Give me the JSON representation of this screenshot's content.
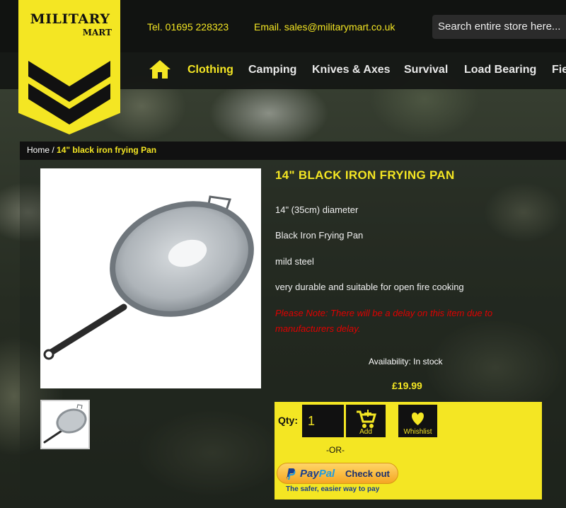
{
  "header": {
    "brand_line1": "MILITARY",
    "brand_line2": "MART",
    "phone": "Tel. 01695 228323",
    "email": "Email. sales@militarymart.co.uk",
    "search_placeholder": "Search entire store here..."
  },
  "nav": {
    "home_icon": "home-icon",
    "items": [
      "Clothing",
      "Camping",
      "Knives & Axes",
      "Survival",
      "Load Bearing",
      "Fie"
    ],
    "active": "Clothing"
  },
  "breadcrumb": {
    "home": "Home",
    "separator": " / ",
    "current": "14\" black iron frying Pan"
  },
  "product": {
    "title": "14\" BLACK IRON FRYING PAN",
    "features": [
      "14\" (35cm) diameter",
      "Black Iron Frying Pan",
      "mild steel",
      "very durable and suitable for open fire cooking"
    ],
    "note": "Please Note: There will be a delay on this item due to manufacturers delay.",
    "availability": "Availability: In stock",
    "price": "£19.99"
  },
  "buy": {
    "qty_label": "Qty:",
    "qty_value": "1",
    "add_label": "Add",
    "wishlist_label": "Whishlist",
    "or_text": "-OR-",
    "paypal_brand_a": "Pay",
    "paypal_brand_b": "Pal",
    "paypal_checkout": "Check out",
    "paypal_tagline": "The safer, easier way to pay"
  },
  "colors": {
    "brand_yellow": "#f4e623",
    "note_red": "#e00000",
    "dark": "#111311"
  }
}
